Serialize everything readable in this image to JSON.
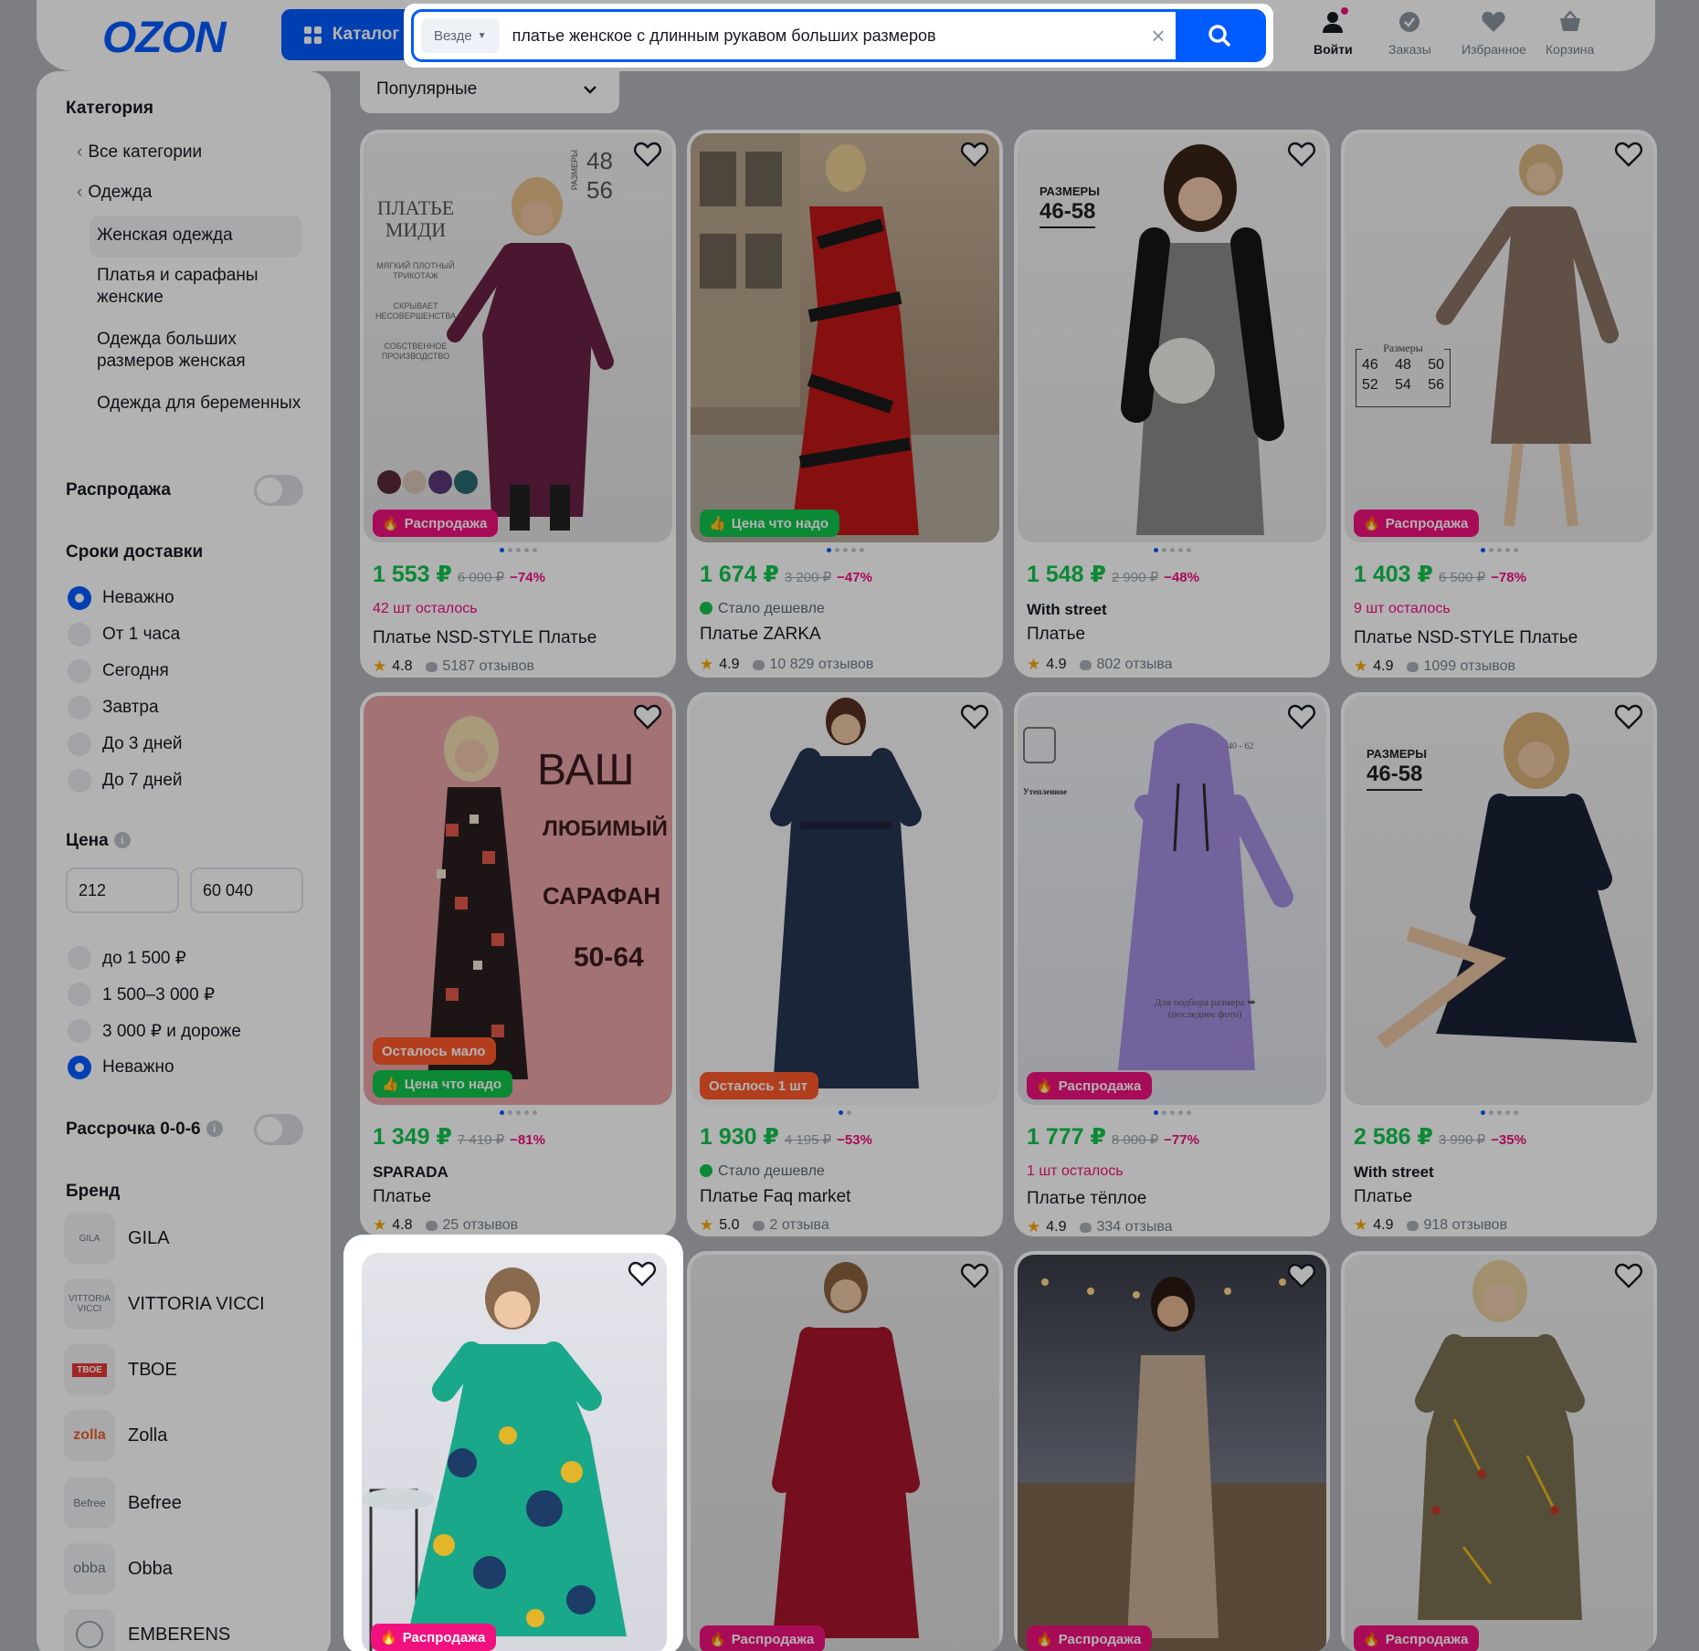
{
  "header": {
    "logo": "OZON",
    "catalog_label": "Каталог",
    "search_scope": "Везде",
    "search_value": "платье женское с длинным рукавом больших размеров",
    "nav": [
      {
        "label": "Войти",
        "icon": "user-icon"
      },
      {
        "label": "Заказы",
        "icon": "orders-icon"
      },
      {
        "label": "Избранное",
        "icon": "heart-icon"
      },
      {
        "label": "Корзина",
        "icon": "cart-icon"
      }
    ]
  },
  "sort": {
    "label": "Популярные"
  },
  "sidebar": {
    "category_title": "Категория",
    "categories": [
      {
        "label": "Все категории"
      },
      {
        "label": "Одежда"
      }
    ],
    "subcategories": [
      {
        "label": "Женская одежда"
      },
      {
        "label": "Платья и сарафаны женские"
      },
      {
        "label": "Одежда больших размеров женская"
      },
      {
        "label": "Одежда для беременных"
      }
    ],
    "sale_title": "Распродажа",
    "delivery_title": "Сроки доставки",
    "delivery_options": [
      "Неважно",
      "От 1 часа",
      "Сегодня",
      "Завтра",
      "До 3 дней",
      "До 7 дней"
    ],
    "price_title": "Цена",
    "price_min": "212",
    "price_max": "60 040",
    "price_options": [
      "до 1 500 ₽",
      "1 500–3 000 ₽",
      "3 000 ₽ и дороже",
      "Неважно"
    ],
    "installment_title": "Рассрочка 0-0-6",
    "brand_title": "Бренд",
    "brands": [
      {
        "name": "GILA",
        "logo": "GILA"
      },
      {
        "name": "VITTORIA VICCI",
        "logo": "VITTORIA VICCI"
      },
      {
        "name": "ТВОЕ",
        "logo": "ТВОЕ"
      },
      {
        "name": "Zolla",
        "logo": "zolla"
      },
      {
        "name": "Befree",
        "logo": "Befree"
      },
      {
        "name": "Obba",
        "logo": "obba"
      },
      {
        "name": "EMBERENS",
        "logo": ""
      }
    ]
  },
  "products": [
    {
      "badge": "Распродажа",
      "price": "1 553 ₽",
      "old": "6 000 ₽",
      "disc": "−74%",
      "note": "42 шт осталось",
      "title": "Платье NSD-STYLE Платье",
      "rating": "4.8",
      "reviews": "5187 отзывов",
      "photo_text": [
        "ПЛАТЬЕ",
        "МИДИ",
        "МЯГКИЙ ПЛОТНЫЙ",
        "ТРИКОТАЖ",
        "СКРЫВАЕТ",
        "НЕСОВЕРШЕНСТВА",
        "СОБСТВЕННОЕ",
        "ПРОИЗВОДСТВО",
        "РАЗМЕРЫ",
        "48",
        "56"
      ]
    },
    {
      "badge": "Цена что надо",
      "price": "1 674 ₽",
      "old": "3 200 ₽",
      "disc": "−47%",
      "note": "Стало дешевле",
      "title": "Платье ZARKA",
      "rating": "4.9",
      "reviews": "10 829 отзывов"
    },
    {
      "badge": "",
      "price": "1 548 ₽",
      "old": "2 990 ₽",
      "disc": "−48%",
      "brand": "With street",
      "title": "Платье",
      "rating": "4.9",
      "reviews": "802 отзыва",
      "photo_text": [
        "РАЗМЕРЫ",
        "46-58"
      ]
    },
    {
      "badge": "Распродажа",
      "price": "1 403 ₽",
      "old": "6 500 ₽",
      "disc": "−78%",
      "note": "9 шт осталось",
      "title": "Платье NSD-STYLE Платье",
      "rating": "4.9",
      "reviews": "1099 отзывов",
      "photo_text": [
        "Размеры",
        "46",
        "48",
        "50",
        "52",
        "54",
        "56"
      ]
    },
    {
      "badge": "Осталось мало",
      "badge2": "Цена что надо",
      "price": "1 349 ₽",
      "old": "7 410 ₽",
      "disc": "−81%",
      "brand": "SPARADA",
      "title": "Платье",
      "rating": "4.8",
      "reviews": "25 отзывов",
      "photo_text": [
        "ВАШ",
        "ЛЮБИМЫЙ",
        "САРАФАН",
        "50-64"
      ]
    },
    {
      "badge": "Осталось 1 шт",
      "price": "1 930 ₽",
      "old": "4 195 ₽",
      "disc": "−53%",
      "note": "Стало дешевле",
      "title": "Платье Faq market",
      "rating": "5.0",
      "reviews": "2 отзыва"
    },
    {
      "badge": "Распродажа",
      "price": "1 777 ₽",
      "old": "8 000 ₽",
      "disc": "−77%",
      "note": "1 шт осталось",
      "title": "Платье тёплое",
      "rating": "4.9",
      "reviews": "334 отзыва",
      "photo_text": [
        "40 - 62",
        "Утепленное",
        "Для подбора размера",
        "(последнее фото)"
      ]
    },
    {
      "badge": "",
      "price": "2 586 ₽",
      "old": "3 990 ₽",
      "disc": "−35%",
      "brand": "With street",
      "title": "Платье",
      "rating": "4.9",
      "reviews": "918 отзывов",
      "photo_text": [
        "РАЗМЕРЫ",
        "46-58"
      ]
    },
    {
      "badge": "Распродажа"
    },
    {
      "badge": "Распродажа"
    },
    {
      "badge": "Распродажа"
    },
    {
      "badge": "Распродажа"
    }
  ],
  "colors": {
    "brand": "#005bff",
    "price": "#10c44c",
    "sale": "#f1117e",
    "warn": "#ff5a2c"
  }
}
